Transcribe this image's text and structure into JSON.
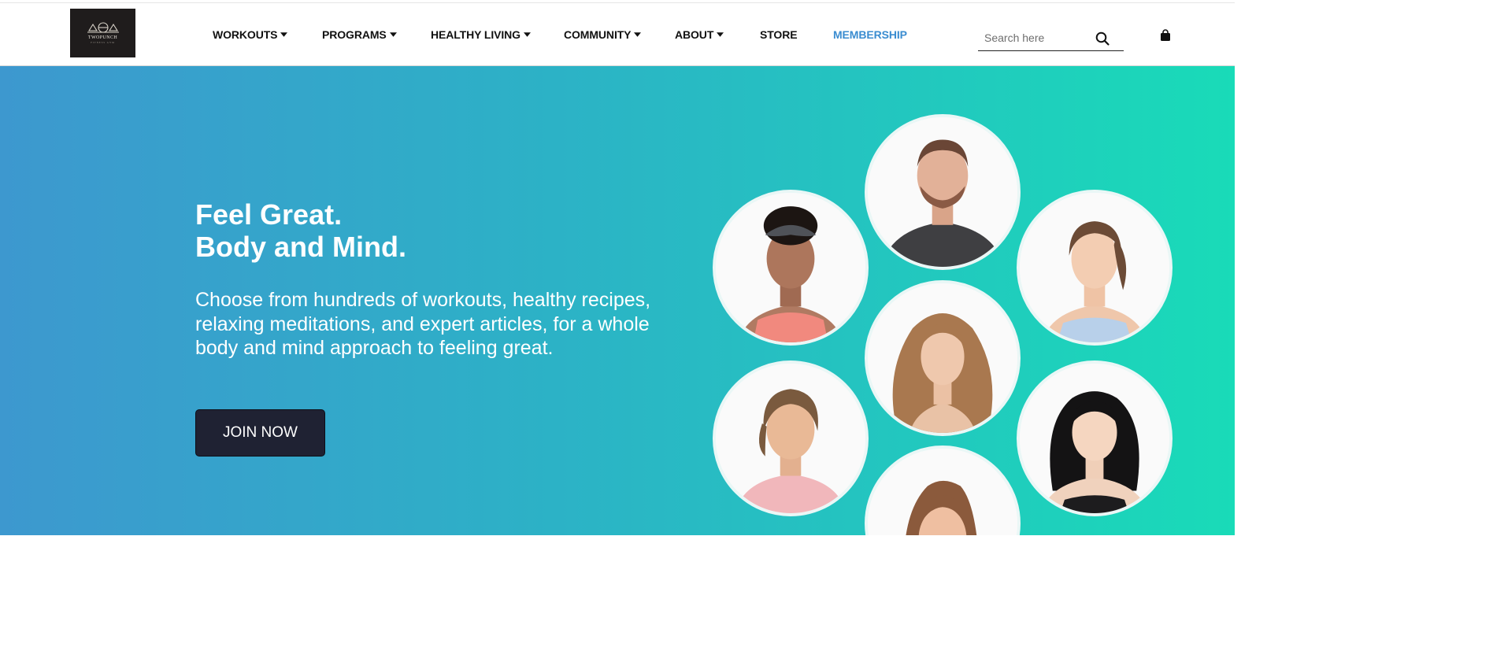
{
  "brand": {
    "name": "TWOPUNCH",
    "tagline": "FITNESS GYM"
  },
  "nav": {
    "items": [
      {
        "label": "WORKOUTS",
        "dropdown": true
      },
      {
        "label": "PROGRAMS",
        "dropdown": true
      },
      {
        "label": "HEALTHY LIVING",
        "dropdown": true
      },
      {
        "label": "COMMUNITY",
        "dropdown": true
      },
      {
        "label": "ABOUT",
        "dropdown": true
      },
      {
        "label": "STORE",
        "dropdown": false
      },
      {
        "label": "MEMBERSHIP",
        "dropdown": false
      }
    ],
    "membership_color": "#3a8cd0"
  },
  "search": {
    "placeholder": "Search here",
    "value": "",
    "icon": "search-icon"
  },
  "cart": {
    "icon": "shopping-bag-icon"
  },
  "hero": {
    "headline_line1": "Feel Great.",
    "headline_line2": "Body and Mind.",
    "description": "Choose from hundreds of workouts, healthy recipes, relaxing meditations, and expert articles, for a whole body and mind approach to feeling great.",
    "cta_label": "JOIN NOW",
    "gradient": [
      "#3d98cf",
      "#19dbb8"
    ],
    "button_color": "#1f2233"
  },
  "trainers": [
    {
      "id": "trainer-1"
    },
    {
      "id": "trainer-2"
    },
    {
      "id": "trainer-3"
    },
    {
      "id": "trainer-4"
    },
    {
      "id": "trainer-5"
    },
    {
      "id": "trainer-6"
    },
    {
      "id": "trainer-7"
    }
  ]
}
